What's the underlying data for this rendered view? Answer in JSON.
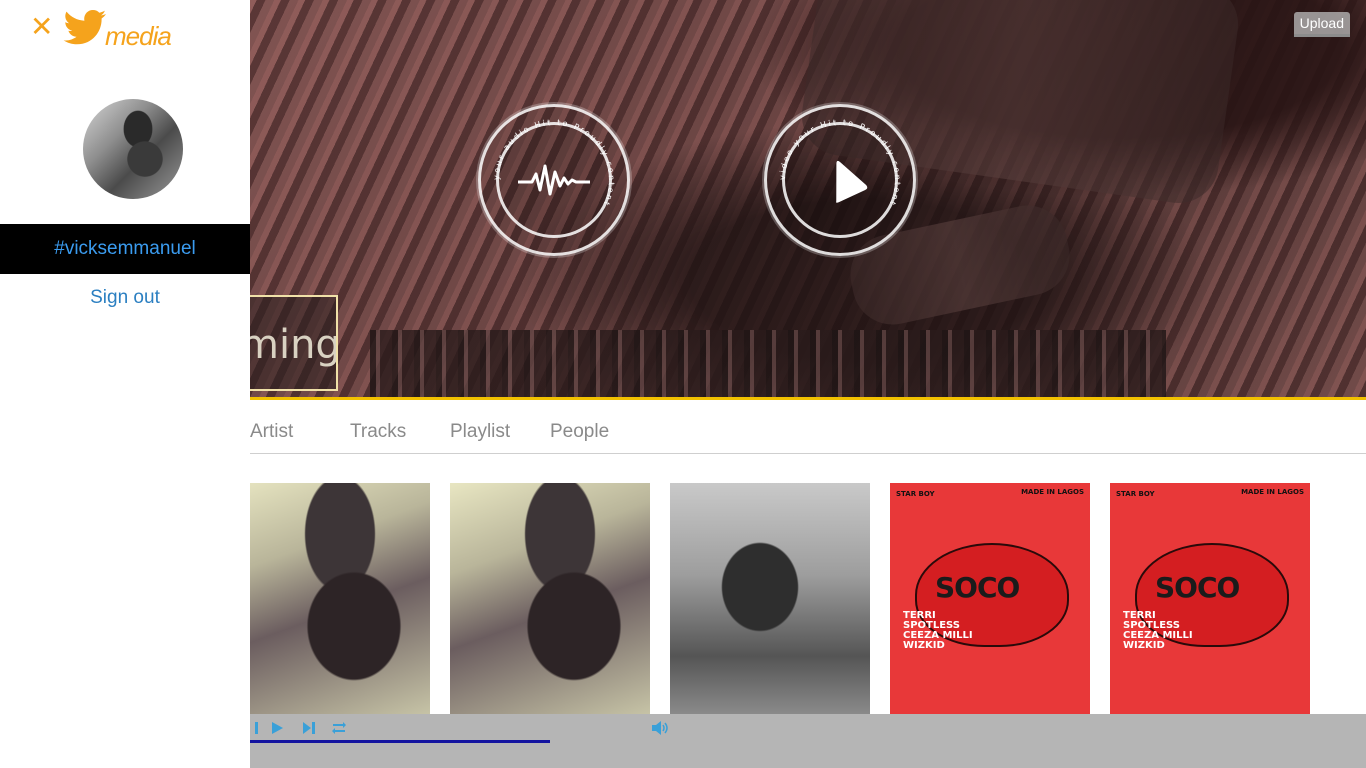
{
  "brand": {
    "name": "media",
    "close_symbol": "✕",
    "color": "#f5a31c"
  },
  "user": {
    "handle": "#vicksemmanuel",
    "signout_label": "Sign out"
  },
  "hero": {
    "upload_label": "Upload",
    "banner_text": "ming",
    "badges": [
      {
        "ring_text": "your audio Hit to Proudly content",
        "icon": "audio-wave-icon"
      },
      {
        "ring_text": "video your Hit to Proudly content",
        "icon": "play-icon"
      }
    ],
    "accent_color": "#f2c100"
  },
  "tabs": [
    {
      "label": "Artist"
    },
    {
      "label": "Tracks"
    },
    {
      "label": "Playlist"
    },
    {
      "label": "People"
    }
  ],
  "cards": [
    {
      "kind": "photo"
    },
    {
      "kind": "photo"
    },
    {
      "kind": "photo"
    },
    {
      "kind": "album",
      "title": "SOCO",
      "names": [
        "TERRI",
        "SPOTLESS",
        "CEEZA MILLI",
        "WIZKID"
      ],
      "label_right": "MADE IN LAGOS",
      "label_left": "STAR BOY"
    },
    {
      "kind": "album",
      "title": "SOCO",
      "names": [
        "TERRI",
        "SPOTLESS",
        "CEEZA MILLI",
        "WIZKID"
      ],
      "label_right": "MADE IN LAGOS",
      "label_left": "STAR BOY"
    }
  ],
  "player": {
    "controls": [
      "prev-icon",
      "play-icon",
      "next-icon",
      "repeat-icon",
      "volume-icon"
    ],
    "progress_color": "#1414a0",
    "bar_color": "#b5b5b5",
    "icon_color": "#3aa0d8"
  }
}
